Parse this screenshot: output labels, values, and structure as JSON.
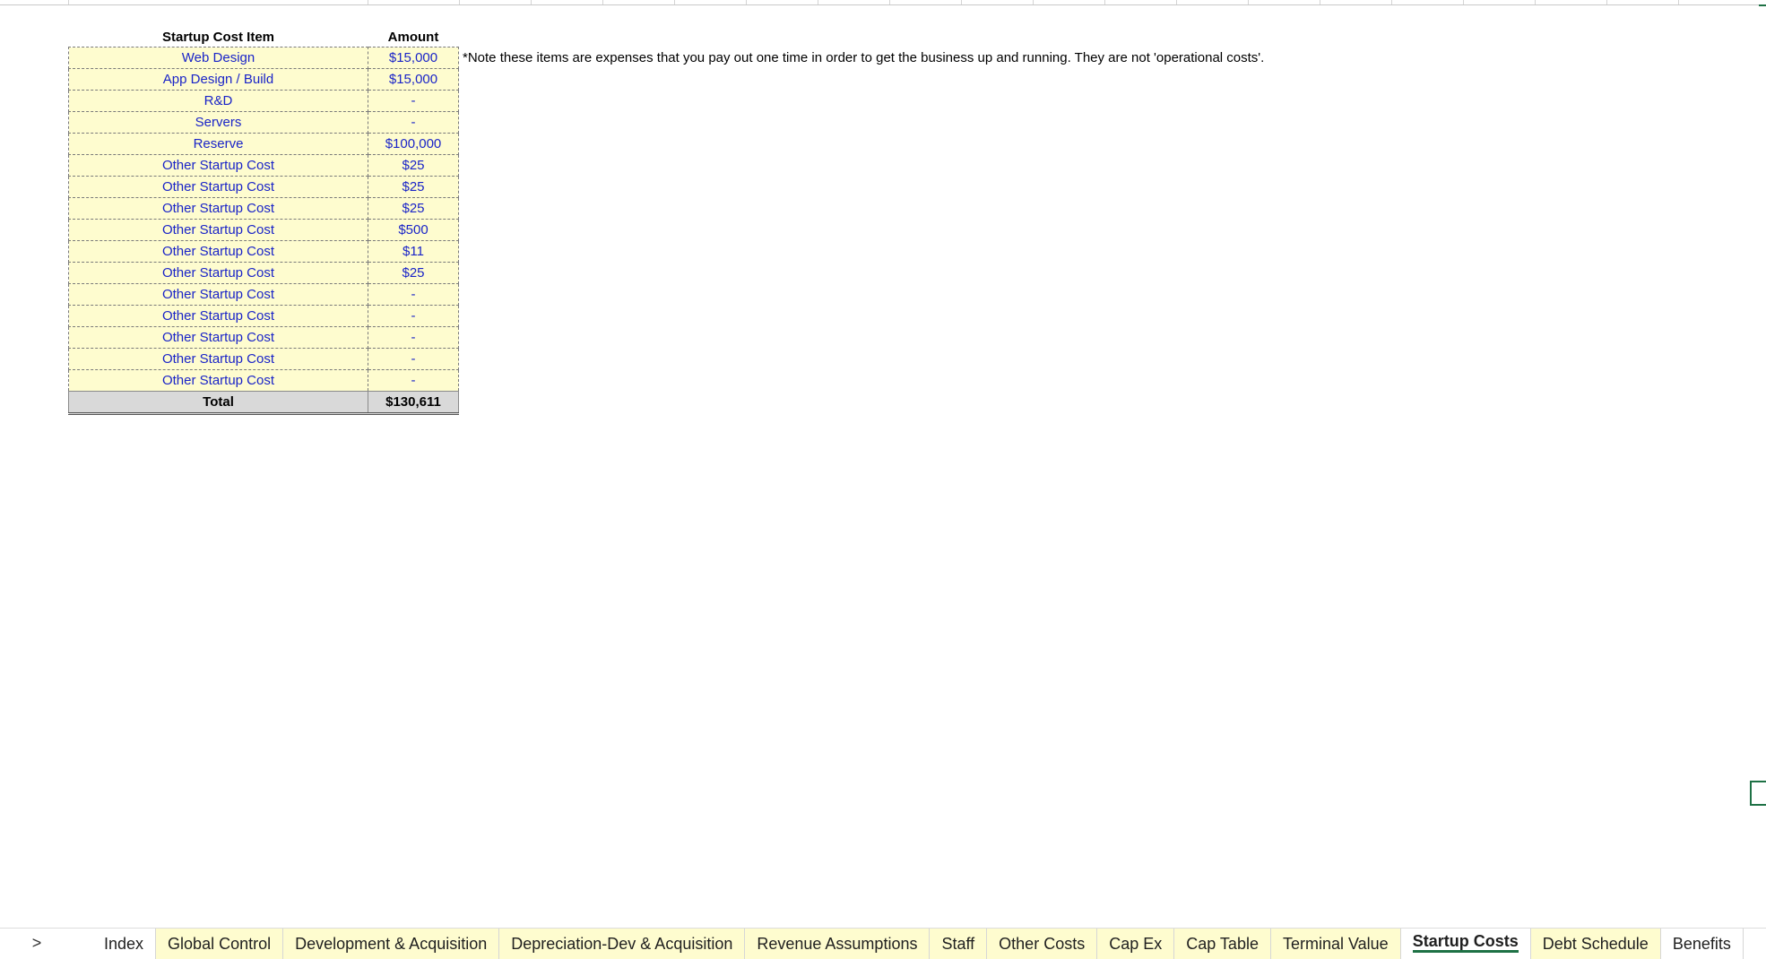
{
  "table": {
    "headers": {
      "item": "Startup Cost Item",
      "amount": "Amount"
    },
    "rows": [
      {
        "item": "Web Design",
        "amount": "$15,000"
      },
      {
        "item": "App Design / Build",
        "amount": "$15,000"
      },
      {
        "item": "R&D",
        "amount": "-"
      },
      {
        "item": "Servers",
        "amount": "-"
      },
      {
        "item": "Reserve",
        "amount": "$100,000"
      },
      {
        "item": "Other Startup Cost",
        "amount": "$25"
      },
      {
        "item": "Other Startup Cost",
        "amount": "$25"
      },
      {
        "item": "Other Startup Cost",
        "amount": "$25"
      },
      {
        "item": "Other Startup Cost",
        "amount": "$500"
      },
      {
        "item": "Other Startup Cost",
        "amount": "$11"
      },
      {
        "item": "Other Startup Cost",
        "amount": "$25"
      },
      {
        "item": "Other Startup Cost",
        "amount": "-"
      },
      {
        "item": "Other Startup Cost",
        "amount": "-"
      },
      {
        "item": "Other Startup Cost",
        "amount": "-"
      },
      {
        "item": "Other Startup Cost",
        "amount": "-"
      },
      {
        "item": "Other Startup Cost",
        "amount": "-"
      }
    ],
    "total": {
      "label": "Total",
      "amount": "$130,611"
    }
  },
  "note": "*Note these items are expenses that you pay out one time in order to get the business up and running. They are not 'operational costs'.",
  "tabbar": {
    "next_icon": "chevron-right-icon",
    "next_glyph": ">",
    "tabs": [
      {
        "label": "Index",
        "style": "plain",
        "active": false
      },
      {
        "label": "Global Control",
        "style": "yellow",
        "active": false
      },
      {
        "label": "Development & Acquisition",
        "style": "yellow",
        "active": false
      },
      {
        "label": "Depreciation-Dev & Acquisition",
        "style": "yellow",
        "active": false
      },
      {
        "label": "Revenue Assumptions",
        "style": "yellow",
        "active": false
      },
      {
        "label": "Staff",
        "style": "yellow",
        "active": false
      },
      {
        "label": "Other Costs",
        "style": "yellow",
        "active": false
      },
      {
        "label": "Cap Ex",
        "style": "yellow",
        "active": false
      },
      {
        "label": "Cap Table",
        "style": "yellow",
        "active": false
      },
      {
        "label": "Terminal Value",
        "style": "yellow",
        "active": false
      },
      {
        "label": "Startup Costs",
        "style": "plain",
        "active": true
      },
      {
        "label": "Debt Schedule",
        "style": "yellow",
        "active": false
      },
      {
        "label": "Benefits",
        "style": "plain",
        "active": false
      }
    ]
  },
  "colors": {
    "input_fill": "#fefccf",
    "input_text": "#1a24c8",
    "total_fill": "#d9d9d9",
    "active_tab_underline": "#1e7145"
  }
}
